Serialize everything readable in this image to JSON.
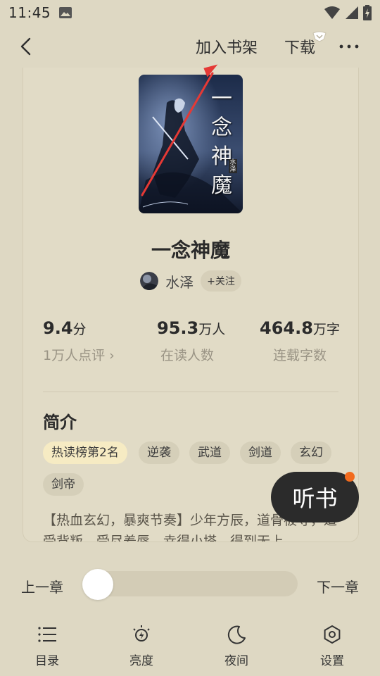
{
  "status_bar": {
    "time": "11:45"
  },
  "nav": {
    "add_to_shelf": "加入书架",
    "download": "下载"
  },
  "book": {
    "title": "一念神魔",
    "author": "水泽",
    "follow_label": "+关注",
    "cover_text": "一念神魔",
    "cover_author": "水泽"
  },
  "stats": [
    {
      "value": "9.4",
      "unit": "分",
      "label": "1万人点评 ›"
    },
    {
      "value": "95.3",
      "unit": "万人",
      "label": "在读人数"
    },
    {
      "value": "464.8",
      "unit": "万字",
      "label": "连载字数"
    }
  ],
  "intro": {
    "title": "简介",
    "tags": [
      "热读榜第2名",
      "逆袭",
      "武道",
      "剑道",
      "玄幻",
      "剑帝"
    ],
    "description": "【热血玄幻，暴爽节奏】少年方辰，道骨被夺，遭受背叛，受尽羞辱，幸得小塔，得到无上"
  },
  "listen_button": "听书",
  "chapter_nav": {
    "prev": "上一章",
    "next": "下一章",
    "progress": 0
  },
  "bottom_nav": [
    {
      "label": "目录",
      "icon": "list-icon"
    },
    {
      "label": "亮度",
      "icon": "brightness-icon"
    },
    {
      "label": "夜间",
      "icon": "moon-icon"
    },
    {
      "label": "设置",
      "icon": "settings-icon"
    }
  ],
  "colors": {
    "background": "#ded8c3",
    "hot_tag": "#f6ebc3",
    "listen_button": "#2b2b2b",
    "notification_dot": "#f26b1d",
    "annotation_arrow": "#e53935"
  }
}
